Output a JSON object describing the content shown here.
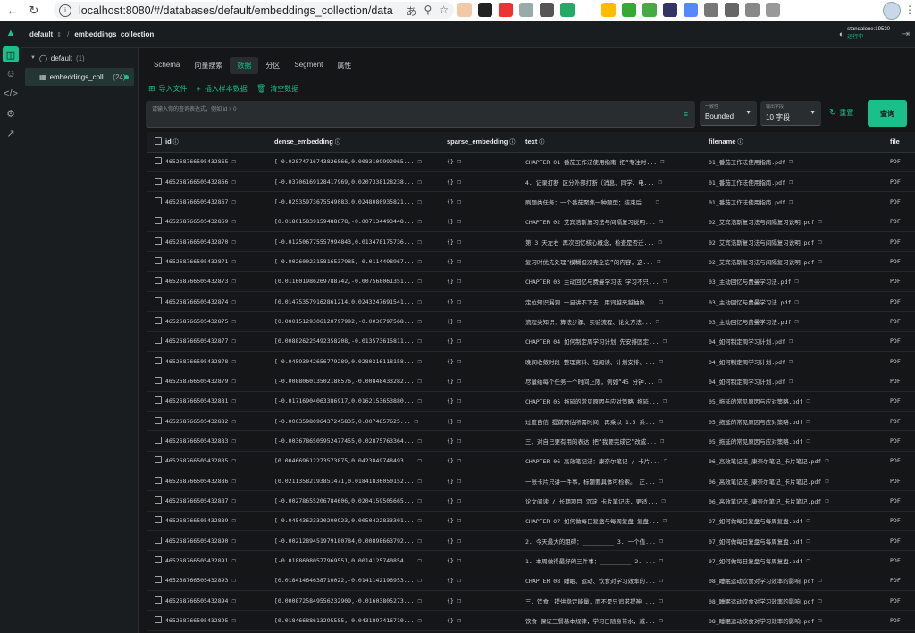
{
  "browser": {
    "url": "localhost:8080/#/databases/default/embeddings_collection/data"
  },
  "topbar": {
    "database": "default",
    "separator": "/",
    "collection": "embeddings_collection",
    "status_name": "standalone:19530",
    "status_state": "运行中"
  },
  "tree": {
    "database_name": "default",
    "database_count": "(1)",
    "collection_name": "embeddings_coll...",
    "collection_count": "(24)"
  },
  "tabs": [
    "Schema",
    "向量搜索",
    "数据",
    "分区",
    "Segment",
    "属性"
  ],
  "actions": {
    "import": "导入文件",
    "insert": "插入样本数据",
    "clear": "清空数据"
  },
  "filter": {
    "placeholder": "请输入你的查询表达式，例如 id > 0"
  },
  "consistency": {
    "label": "一致性",
    "value": "Bounded"
  },
  "output_fields": {
    "label": "输出字段",
    "value": "10 字段"
  },
  "reset_label": "重置",
  "query_label": "查询",
  "columns": [
    "id",
    "dense_embedding",
    "sparse_embedding",
    "text",
    "filename",
    "file"
  ],
  "rows": [
    {
      "id": "465268766505432865",
      "dense": "[-0.02874716743826866,0.0083109992065...",
      "sparse": "{}",
      "text": "CHAPTER 01 番茄工作法使用指南 把“专注时...",
      "filename": "01_番茄工作法使用指南.pdf",
      "file": "PDF"
    },
    {
      "id": "465268766505432866",
      "dense": "[-0.03706169128417969,0.0207338128238...",
      "sparse": "{}",
      "text": "4. 记录打断 区分外部打断（消息、同学、电...",
      "filename": "01_番茄工作法使用指南.pdf",
      "file": "PDF"
    },
    {
      "id": "465268766505432867",
      "dense": "[-0.02535973675549083,0.0248080935821...",
      "sparse": "{}",
      "text": "刷题类任务：一个番茄聚焦一种题型；结束后...",
      "filename": "01_番茄工作法使用指南.pdf",
      "file": "PDF"
    },
    {
      "id": "465268766505432869",
      "dense": "[0.018015839159488678,-0.007134493448...",
      "sparse": "{}",
      "text": "CHAPTER 02 艾宾浩斯复习法与间隔复习说明...",
      "filename": "02_艾宾浩斯复习法与间隔复习说明.pdf",
      "file": "PDF"
    },
    {
      "id": "465268766505432870",
      "dense": "[-0.012506775557994843,0.013478175736...",
      "sparse": "{}",
      "text": "第 3 天左右 再次回忆核心概念，检查是否迁...",
      "filename": "02_艾宾浩斯复习法与间隔复习说明.pdf",
      "file": "PDF"
    },
    {
      "id": "465268766505432871",
      "dense": "[-0.0026002315816537985,-0.0114498967...",
      "sparse": "{}",
      "text": "复习时优先处理“模糊但没完全忘”的内容，这...",
      "filename": "02_艾宾浩斯复习法与间隔复习说明.pdf",
      "file": "PDF"
    },
    {
      "id": "465268766505432873",
      "dense": "[0.011601986269788742,-0.007568061351...",
      "sparse": "{}",
      "text": "CHAPTER 03 主动回忆与费曼学习法 学习不只...",
      "filename": "03_主动回忆与费曼学习法.pdf",
      "file": "PDF"
    },
    {
      "id": "465268766505432874",
      "dense": "[0.014753579162861214,0.0243247691541...",
      "sparse": "{}",
      "text": "定位知识漏洞 一旦讲不下去、用词越来越抽象...",
      "filename": "03_主动回忆与费曼学习法.pdf",
      "file": "PDF"
    },
    {
      "id": "465268766505432875",
      "dense": "[0.00015129306120797992,-0.0030797568...",
      "sparse": "{}",
      "text": "流程类知识：算法步骤、实验流程、论文方法...",
      "filename": "03_主动回忆与费曼学习法.pdf",
      "file": "PDF"
    },
    {
      "id": "465268766505432877",
      "dense": "[0.008826225492358208,-0.013573615811...",
      "sparse": "{}",
      "text": "CHAPTER 04 如何制定周学习计划 先安排固定...",
      "filename": "04_如何制定周学习计划.pdf",
      "file": "PDF"
    },
    {
      "id": "465268766505432878",
      "dense": "[-0.04593042656779289,0.0280316118158...",
      "sparse": "{}",
      "text": "晚间收敛时段 整理资料、轻阅读、计划安排、...",
      "filename": "04_如何制定周学习计划.pdf",
      "file": "PDF"
    },
    {
      "id": "465268766505432879",
      "dense": "[-0.008806013502180576,-0.00848433282...",
      "sparse": "{}",
      "text": "尽量给每个任务一个时间上限，例如“45 分钟...",
      "filename": "04_如何制定周学习计划.pdf",
      "file": "PDF"
    },
    {
      "id": "465268766505432881",
      "dense": "[-0.01716904063386917,0.0162153653880...",
      "sparse": "{}",
      "text": "CHAPTER 05 拖延的常见原因与应对策略 拖延...",
      "filename": "05_拖延的常见原因与应对策略.pdf",
      "file": "PDF"
    },
    {
      "id": "465268766505432882",
      "dense": "[-0.0003598096437245835,0.0074657625...",
      "sparse": "{}",
      "text": "过度自信 提前预估所需时间，再乘以 1.5 系...",
      "filename": "05_拖延的常见原因与应对策略.pdf",
      "file": "PDF"
    },
    {
      "id": "465268766505432883",
      "dense": "[-0.0036786505952477455,0.02875763364...",
      "sparse": "{}",
      "text": "三、对自己更有用的表达 把“我要完成它”改成...",
      "filename": "05_拖延的常见原因与应对策略.pdf",
      "file": "PDF"
    },
    {
      "id": "465268766505432885",
      "dense": "[0.004669612273573875,0.0423849748493...",
      "sparse": "{}",
      "text": "CHAPTER 06 高效笔记法：康奈尔笔记 / 卡片...",
      "filename": "06_高效笔记法_康奈尔笔记_卡片笔记.pdf",
      "file": "PDF"
    },
    {
      "id": "465268766505432886",
      "dense": "[0.02113582193851471,0.01841836050152...",
      "sparse": "{}",
      "text": "一张卡片只讲一件事，标题要具体可检索。 正...",
      "filename": "06_高效笔记法_康奈尔笔记_卡片笔记.pdf",
      "file": "PDF"
    },
    {
      "id": "465268766505432887",
      "dense": "[-0.00278655206784606,0.0204159505665...",
      "sparse": "{}",
      "text": "论文阅读 / 长期项目 沉淀 卡片笔记法，更适...",
      "filename": "06_高效笔记法_康奈尔笔记_卡片笔记.pdf",
      "file": "PDF"
    },
    {
      "id": "465268766505432889",
      "dense": "[-0.04543623320200923,0.0050422833301...",
      "sparse": "{}",
      "text": "CHAPTER 07 如何做每日复盘与每周复盘 复盘...",
      "filename": "07_如何做每日复盘与每周复盘.pdf",
      "file": "PDF"
    },
    {
      "id": "465268766505432890",
      "dense": "[-0.0021289451979180784,0.00898663792...",
      "sparse": "{}",
      "text": "2. 今天最大的阻碍：_________ 3. 一个值...",
      "filename": "07_如何做每日复盘与每周复盘.pdf",
      "file": "PDF"
    },
    {
      "id": "465268766505432891",
      "dense": "[-0.01886080577969551,0.0014125740854...",
      "sparse": "{}",
      "text": "1. 本周做得最好的三件事：_________ 2. ...",
      "filename": "07_如何做每日复盘与每周复盘.pdf",
      "file": "PDF"
    },
    {
      "id": "465268766505432893",
      "dense": "[0.01841464638710022,-0.0141142196953...",
      "sparse": "{}",
      "text": "CHAPTER 08 睡眠、运动、饮食对学习效率的...",
      "filename": "08_睡眠运动饮食对学习效率的影响.pdf",
      "file": "PDF"
    },
    {
      "id": "465268766505432894",
      "dense": "[0.0008725849556232909,-0.01603805273...",
      "sparse": "{}",
      "text": "三、饮食：提供稳定能量，而不是只追求提神 ...",
      "filename": "08_睡眠运动饮食对学习效率的影响.pdf",
      "file": "PDF"
    },
    {
      "id": "465268766505432895",
      "dense": "[0.01846688613295555,-0.0431897416710...",
      "sparse": "{}",
      "text": "饮食 保证三餐基本规律，学习日随身带水，减...",
      "filename": "08_睡眠运动饮食对学习效率的影响.pdf",
      "file": "PDF"
    }
  ]
}
